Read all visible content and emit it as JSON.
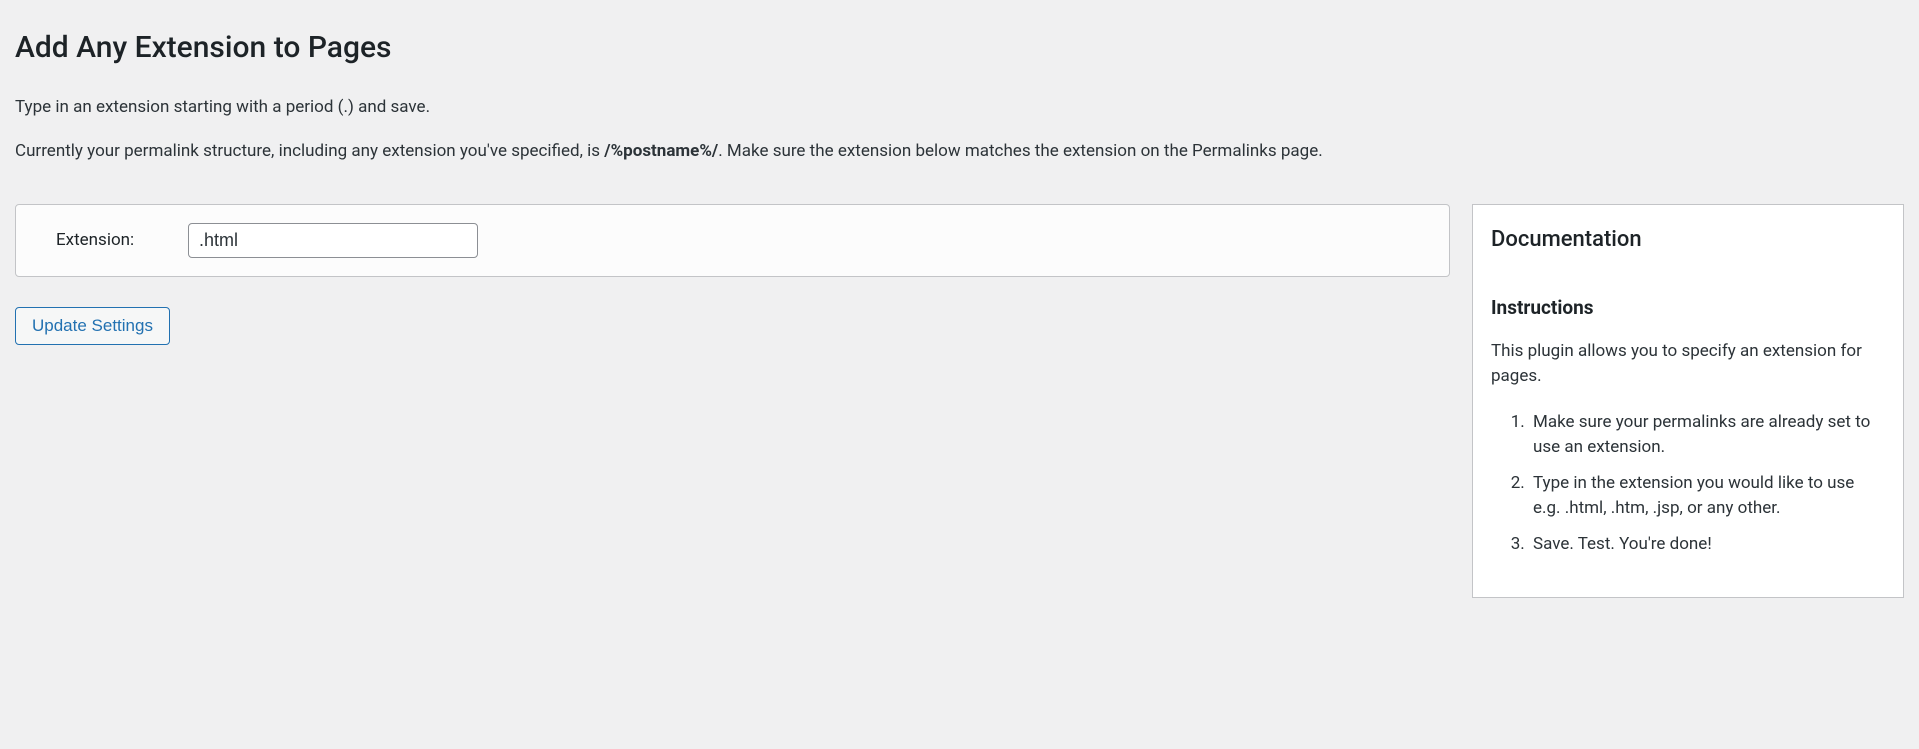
{
  "page": {
    "title": "Add Any Extension to Pages",
    "intro1": "Type in an extension starting with a period (.) and save.",
    "intro2_a": "Currently your permalink structure, including any extension you've specified, is ",
    "intro2_strong": "/%postname%/",
    "intro2_b": ". Make sure the extension below matches the extension on the Permalinks page."
  },
  "form": {
    "extension_label": "Extension:",
    "extension_value": ".html",
    "submit_label": "Update Settings"
  },
  "doc": {
    "heading": "Documentation",
    "subheading": "Instructions",
    "desc": "This plugin allows you to specify an extension for pages.",
    "steps": [
      "Make sure your permalinks are already set to use an extension.",
      "Type in the extension you would like to use e.g. .html, .htm, .jsp, or any other.",
      "Save. Test. You're done!"
    ]
  }
}
